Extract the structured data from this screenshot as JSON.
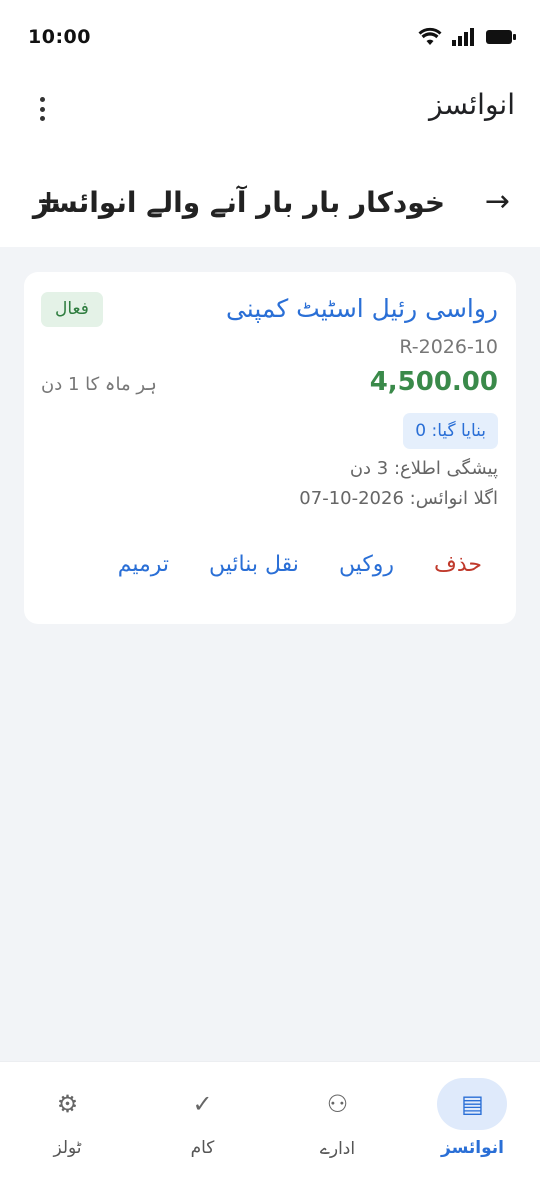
{
  "status_bar": {
    "time": "10:00",
    "icons": [
      "wifi-icon",
      "signal-icon",
      "battery-icon"
    ]
  },
  "app_bar": {
    "title": "انوائسز",
    "menu_icon": "more-vert-icon"
  },
  "sub_header": {
    "title": "خودکار بار بار آنے والے انوائسز",
    "back_icon": "arrow-right-icon",
    "add_icon": "plus-icon",
    "back_glyph": "→",
    "add_glyph": "+"
  },
  "recurring_invoice": {
    "customer": "رواسی رئیل اسٹیٹ کمپنی",
    "status": "فعال",
    "invoice_number": "R-2026-10",
    "amount": "4,500.00",
    "frequency": "ہر ماہ کا 1 دن",
    "created_count": "بنایا گیا: 0",
    "advance_notice": "پیشگی اطلاع: 3 دن",
    "next_invoice": "اگلا انوائس: 2026-10-07",
    "actions": {
      "edit": "ترمیم",
      "duplicate": "نقل بنائیں",
      "pause": "روکیں",
      "delete": "حذف"
    }
  },
  "bottom_nav": {
    "items": [
      {
        "label": "انوائسز",
        "icon": "invoice-list-icon",
        "glyph": "▤",
        "active": true
      },
      {
        "label": "ادارے",
        "icon": "entities-icon",
        "glyph": "⚇",
        "active": false
      },
      {
        "label": "کام",
        "icon": "check-icon",
        "glyph": "✓",
        "active": false
      },
      {
        "label": "ٹولز",
        "icon": "tools-gear-icon",
        "glyph": "⚙",
        "active": false
      }
    ]
  },
  "colors": {
    "accent": "#2a6fd6",
    "success": "#3a8a4a",
    "danger": "#c0392b",
    "background": "#f2f4f7"
  }
}
